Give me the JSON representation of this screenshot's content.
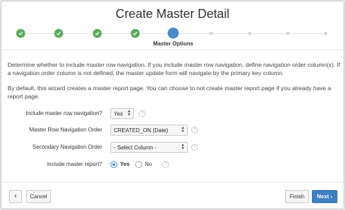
{
  "dialog": {
    "title": "Create Master Detail"
  },
  "wizard": {
    "current_step_label": "Master Options",
    "steps_completed": 4,
    "steps_total": 10
  },
  "intro": {
    "paragraph1": "Determine whether to include master row navigation. If you include master row navigation, define navigation order column(s). If a navigation order column is not defined, the master update form will navigate by the primary key column.",
    "paragraph2": "By default, this wizard creates a master report page. You can choose to not create master report page if you already have a report page."
  },
  "form": {
    "include_nav": {
      "label": "Include master row navigation?",
      "value": "Yes"
    },
    "nav_order": {
      "label": "Master Row Navigation Order",
      "value": "CREATED_ON (Date)"
    },
    "secondary_nav": {
      "label": "Secondary Navigation Order",
      "value": "- Select Column -"
    },
    "include_report": {
      "label": "Include master report?",
      "options": [
        "Yes",
        "No"
      ],
      "selected": "Yes"
    },
    "help_glyph": "?"
  },
  "footer": {
    "back_glyph": "‹",
    "cancel_label": "Cancel",
    "finish_label": "Finish",
    "next_label": "Next",
    "next_glyph": "›"
  },
  "colors": {
    "accent": "#3c7fc2",
    "step_done": "#5dab5d",
    "step_current": "#4a89c8"
  }
}
